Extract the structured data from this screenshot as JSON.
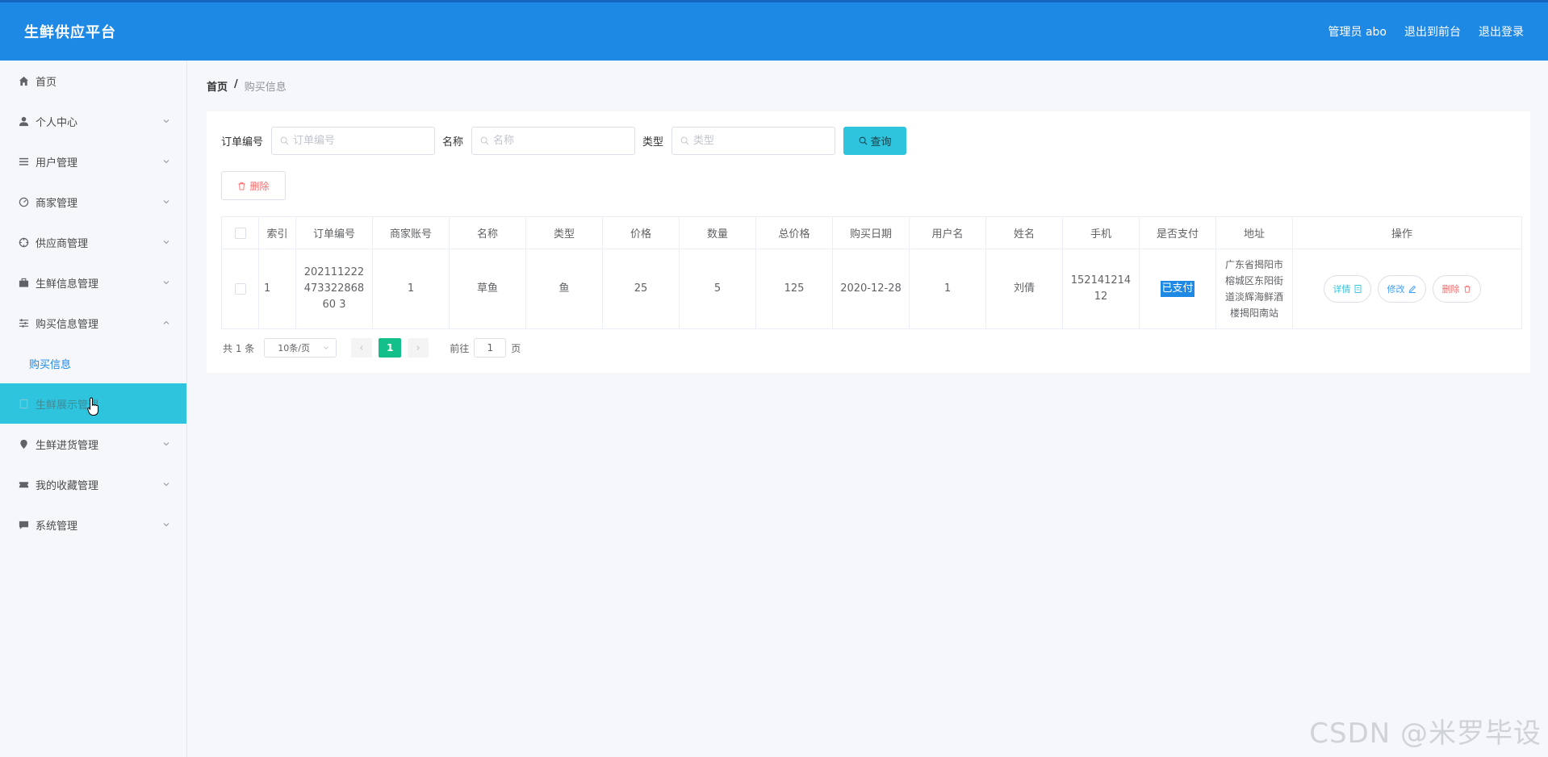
{
  "header": {
    "brand": "生鲜供应平台",
    "admin": "管理员 abo",
    "exit_front": "退出到前台",
    "logout": "退出登录"
  },
  "sidebar": {
    "items": [
      {
        "label": "首页",
        "icon": "home-icon"
      },
      {
        "label": "个人中心",
        "icon": "user-icon"
      },
      {
        "label": "用户管理",
        "icon": "list-icon"
      },
      {
        "label": "商家管理",
        "icon": "odometer-icon"
      },
      {
        "label": "供应商管理",
        "icon": "crosshair-icon"
      },
      {
        "label": "生鲜信息管理",
        "icon": "suitcase-icon"
      },
      {
        "label": "购买信息管理",
        "icon": "sliders-icon"
      },
      {
        "label": "生鲜展示管理",
        "icon": "document-icon"
      },
      {
        "label": "生鲜进货管理",
        "icon": "pin-icon"
      },
      {
        "label": "我的收藏管理",
        "icon": "ticket-icon"
      },
      {
        "label": "系统管理",
        "icon": "chat-icon"
      }
    ],
    "sub_item": "购买信息"
  },
  "breadcrumb": {
    "home": "首页",
    "sep": "/",
    "current": "购买信息"
  },
  "search": {
    "order_label": "订单编号",
    "order_placeholder": "订单编号",
    "name_label": "名称",
    "name_placeholder": "名称",
    "type_label": "类型",
    "type_placeholder": "类型",
    "query": "查询"
  },
  "actions": {
    "delete": "删除"
  },
  "table": {
    "headers": [
      "索引",
      "订单编号",
      "商家账号",
      "名称",
      "类型",
      "价格",
      "数量",
      "总价格",
      "购买日期",
      "用户名",
      "姓名",
      "手机",
      "是否支付",
      "地址",
      "操作"
    ],
    "row": {
      "index": "1",
      "order_no": "20211122247332286860 3",
      "merchant": "1",
      "name": "草鱼",
      "type": "鱼",
      "price": "25",
      "qty": "5",
      "total": "125",
      "date": "2020-12-28",
      "username": "1",
      "realname": "刘倩",
      "phone": "15214121412",
      "paid": "已支付",
      "address": "广东省揭阳市榕城区东阳街道淡辉海鲜酒楼揭阳南站",
      "op_detail": "详情",
      "op_edit": "修改",
      "op_delete": "删除"
    }
  },
  "pager": {
    "total": "共 1 条",
    "size": "10条/页",
    "page": "1",
    "goto_prefix": "前往",
    "goto_value": "1",
    "goto_suffix": "页"
  },
  "watermark": "CSDN @米罗毕设"
}
